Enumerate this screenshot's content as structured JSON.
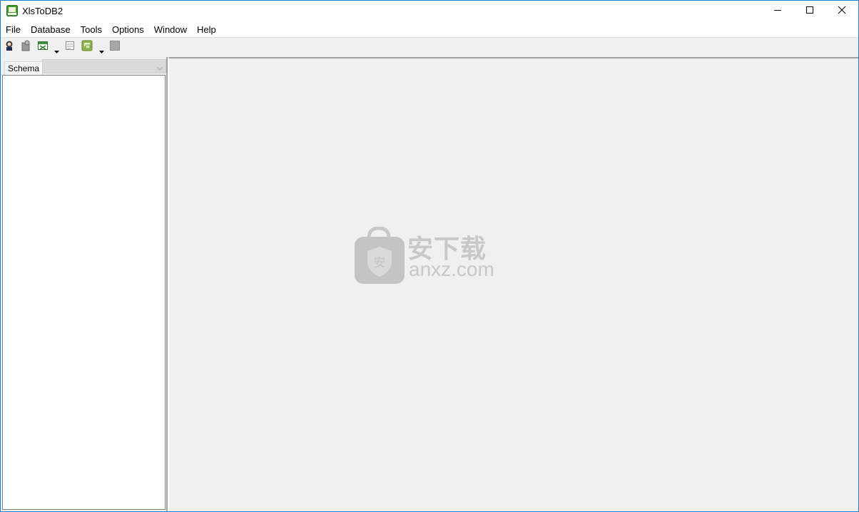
{
  "window": {
    "title": "XlsToDB2",
    "controls": {
      "minimize": "minimize-icon",
      "maximize": "maximize-icon",
      "close": "close-icon"
    }
  },
  "menu": {
    "items": [
      {
        "label": "File"
      },
      {
        "label": "Database"
      },
      {
        "label": "Tools"
      },
      {
        "label": "Options"
      },
      {
        "label": "Window"
      },
      {
        "label": "Help"
      }
    ]
  },
  "toolbar": {
    "buttons": [
      {
        "icon": "connect-icon"
      },
      {
        "icon": "disconnect-icon"
      },
      {
        "icon": "excel-import-icon"
      },
      {
        "icon": "dropdown-arrow-icon"
      },
      {
        "icon": "form-icon"
      },
      {
        "icon": "window-switch-icon"
      },
      {
        "icon": "dropdown-arrow-icon"
      },
      {
        "icon": "stop-icon"
      }
    ]
  },
  "left_pane": {
    "schema_label": "Schema",
    "schema_value": ""
  },
  "watermark": {
    "cn_text": "安下载",
    "en_text": "anxz.com",
    "badge_char": "安"
  },
  "colors": {
    "window_border": "#1b7fd1",
    "panel_bg": "#f0f0f0",
    "watermark": "#c8c8c8"
  }
}
